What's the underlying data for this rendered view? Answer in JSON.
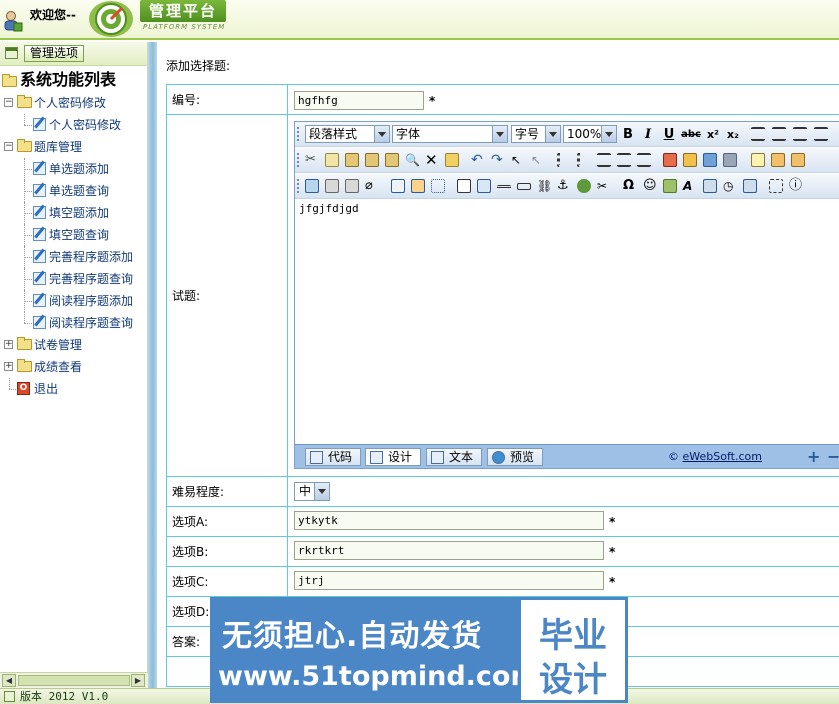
{
  "header": {
    "welcome": "欢迎您--",
    "brand": "管理平台",
    "brand_sub": "PLATFORM SYSTEM"
  },
  "sidebar": {
    "manage_button": "管理选项",
    "tree_title": "系统功能列表",
    "groups": [
      {
        "label": "个人密码修改",
        "items": [
          "个人密码修改"
        ]
      },
      {
        "label": "题库管理",
        "items": [
          "单选题添加",
          "单选题查询",
          "填空题添加",
          "填空题查询",
          "完善程序题添加",
          "完善程序题查询",
          "阅读程序题添加",
          "阅读程序题查询"
        ]
      },
      {
        "label": "试卷管理"
      },
      {
        "label": "成绩查看"
      }
    ],
    "exit": "退出"
  },
  "main": {
    "title": "添加选择题:",
    "fields": {
      "number_label": "编号:",
      "number_value": "hgfhfg",
      "question_label": "试题:",
      "difficulty_label": "难易程度:",
      "difficulty_value": "中",
      "option_a_label": "选项A:",
      "option_a_value": "ytkytk",
      "option_b_label": "选项B:",
      "option_b_value": "rkrtkrt",
      "option_c_label": "选项C:",
      "option_c_value": "jtrj",
      "option_d_label": "选项D:",
      "answer_label": "答案:",
      "required_mark": "*"
    },
    "editor": {
      "paragraph_style": "段落样式",
      "font": "字体",
      "font_size": "字号",
      "zoom": "100%",
      "bold": "B",
      "italic": "I",
      "underline": "U",
      "strike": "abc",
      "superscript": "x²",
      "subscript": "x₂",
      "content": "jfgjfdjgd",
      "tabs": [
        "代码",
        "设计",
        "文本",
        "预览"
      ],
      "copyright_prefix": "© ",
      "copyright_link": "eWebSoft.com",
      "zoom_in": "+",
      "zoom_out": "−"
    }
  },
  "statusbar": {
    "version": "版本 2012 V1.0"
  },
  "watermark": {
    "slogan": "无须担心.自动发货",
    "url": "www.51topmind.com",
    "badge_line1": "毕业",
    "badge_line2": "设计"
  },
  "colors": {
    "accent_green": "#7ab83a",
    "form_border": "#5ecbe0",
    "watermark_blue": "#4b86c7"
  }
}
